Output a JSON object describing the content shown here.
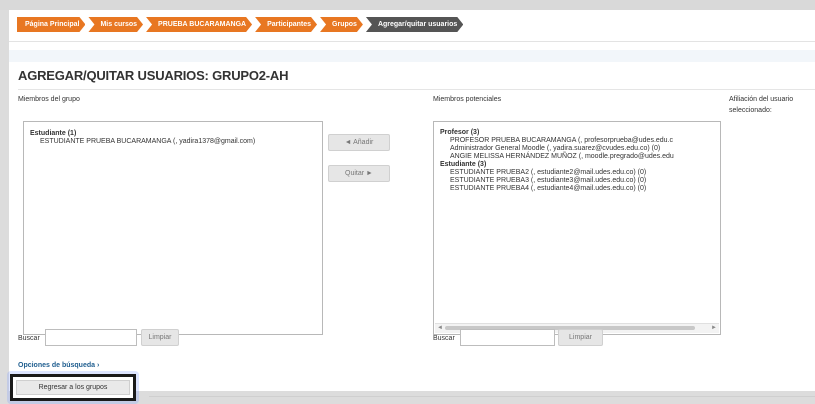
{
  "breadcrumb": [
    "Página Principal",
    "Mis cursos",
    "PRUEBA BUCARAMANGA",
    "Participantes",
    "Grupos",
    "Agregar/quitar usuarios"
  ],
  "page_title": "AGREGAR/QUITAR USUARIOS: GRUPO2-AH",
  "members": {
    "label": "Miembros del grupo",
    "groups": [
      {
        "name": "Estudiante (1)",
        "options": [
          "ESTUDIANTE PRUEBA BUCARAMANGA (, yadira1378@gmail.com)"
        ]
      }
    ],
    "search_label": "Buscar",
    "search_value": "",
    "clear_label": "Limpiar"
  },
  "actions": {
    "add_label": "◄ Añadir",
    "remove_label": "Quitar ►"
  },
  "potential": {
    "label": "Miembros potenciales",
    "groups": [
      {
        "name": "Profesor (3)",
        "options": [
          "PROFESOR PRUEBA BUCARAMANGA (, profesorprueba@udes.edu.c",
          "Administrador General Moodle (, yadira.suarez@cvudes.edu.co) (0)",
          "ANGIE MELISSA HERNÁNDEZ MUÑOZ (, moodle.pregrado@udes.edu"
        ]
      },
      {
        "name": "Estudiante (3)",
        "options": [
          "ESTUDIANTE PRUEBA2 (, estudiante2@mail.udes.edu.co) (0)",
          "ESTUDIANTE PRUEBA3 (, estudiante3@mail.udes.edu.co) (0)",
          "ESTUDIANTE PRUEBA4 (, estudiante4@mail.udes.edu.co) (0)"
        ]
      }
    ],
    "search_label": "Buscar",
    "search_value": "",
    "clear_label": "Limpiar"
  },
  "affiliation": {
    "label_line1": "Afiliación del usuario",
    "label_line2": "seleccionado:"
  },
  "search_options_link": "Opciones de búsqueda ›",
  "back_button": "Regresar a los grupos",
  "colors": {
    "breadcrumb_orange": "#e87722",
    "breadcrumb_current": "#555555",
    "link_blue": "#1f5e8f"
  }
}
